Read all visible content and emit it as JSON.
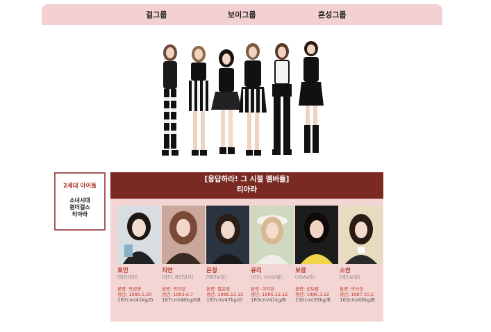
{
  "nav": {
    "items": [
      {
        "label": "걸그룹"
      },
      {
        "label": "보이그룹"
      },
      {
        "label": "혼성그룹"
      }
    ]
  },
  "sidebar": {
    "title": "2세대 아이돌",
    "links": [
      "소녀시대",
      "원더걸스",
      "티아라"
    ]
  },
  "card": {
    "subtitle": "[응답하라! 그 시절 멤버들]",
    "group": "티아라",
    "members": [
      {
        "name": "효민",
        "role": "[메인래퍼]",
        "realname": "본명: 박선영",
        "birth": "생년: 1989.5.30",
        "body": "167cm/41kg/O"
      },
      {
        "name": "지연",
        "role": "[센터, 메인댄서]",
        "realname": "본명: 박지연",
        "birth": "생년: 1993.6.7",
        "body": "167cm/46kg/AB"
      },
      {
        "name": "은정",
        "role": "[메인보컬]",
        "realname": "본명: 함은정",
        "birth": "생년: 1988.12.12",
        "body": "167cm/47kg/O"
      },
      {
        "name": "큐리",
        "role": "[리더, 서브보컬]",
        "realname": "본명: 이지현",
        "birth": "생년: 1986.12.12",
        "body": "163cm/41kg/B"
      },
      {
        "name": "보람",
        "role": "[서브보컬]",
        "realname": "본명: 전보람",
        "birth": "생년: 1986.3.22",
        "body": "150cm/35kg/B"
      },
      {
        "name": "소연",
        "role": "[메인보컬]",
        "realname": "본명: 박소연",
        "birth": "생년: 1987.10.5",
        "body": "163cm/45kg/B"
      }
    ]
  }
}
